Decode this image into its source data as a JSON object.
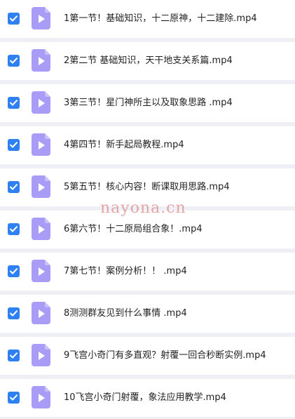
{
  "colors": {
    "background": "#eef0f5",
    "row": "#ffffff",
    "checkbox": "#2f80f0",
    "file_icon": "#a99cf6",
    "watermark": "#d66060"
  },
  "icons": {
    "checkbox": "checkbox-checked-icon",
    "file": "video-file-icon"
  },
  "files": [
    {
      "name": "1第一节！基础知识，十二原神，十二建除.mp4",
      "checked": true
    },
    {
      "name": "2第二节 基础知识，天干地支关系篇.mp4",
      "checked": true
    },
    {
      "name": "3第三节！星门神所主以及取象思路 .mp4",
      "checked": true
    },
    {
      "name": "4第四节！新手起局教程.mp4",
      "checked": true
    },
    {
      "name": "5第五节！核心内容！断课取用思路.mp4",
      "checked": true
    },
    {
      "name": "6第六节！十二原局组合象！.mp4",
      "checked": true
    },
    {
      "name": "7第七节！案例分析！！ .mp4",
      "checked": true
    },
    {
      "name": "8测测群友见到什么事情 .mp4",
      "checked": true
    },
    {
      "name": "9飞宫小奇门有多直观？射覆一回合秒断实例.mp4",
      "checked": true
    },
    {
      "name": "10飞宫小奇门射覆，象法应用教学.mp4",
      "checked": true
    }
  ],
  "watermark": "nayona.cn"
}
